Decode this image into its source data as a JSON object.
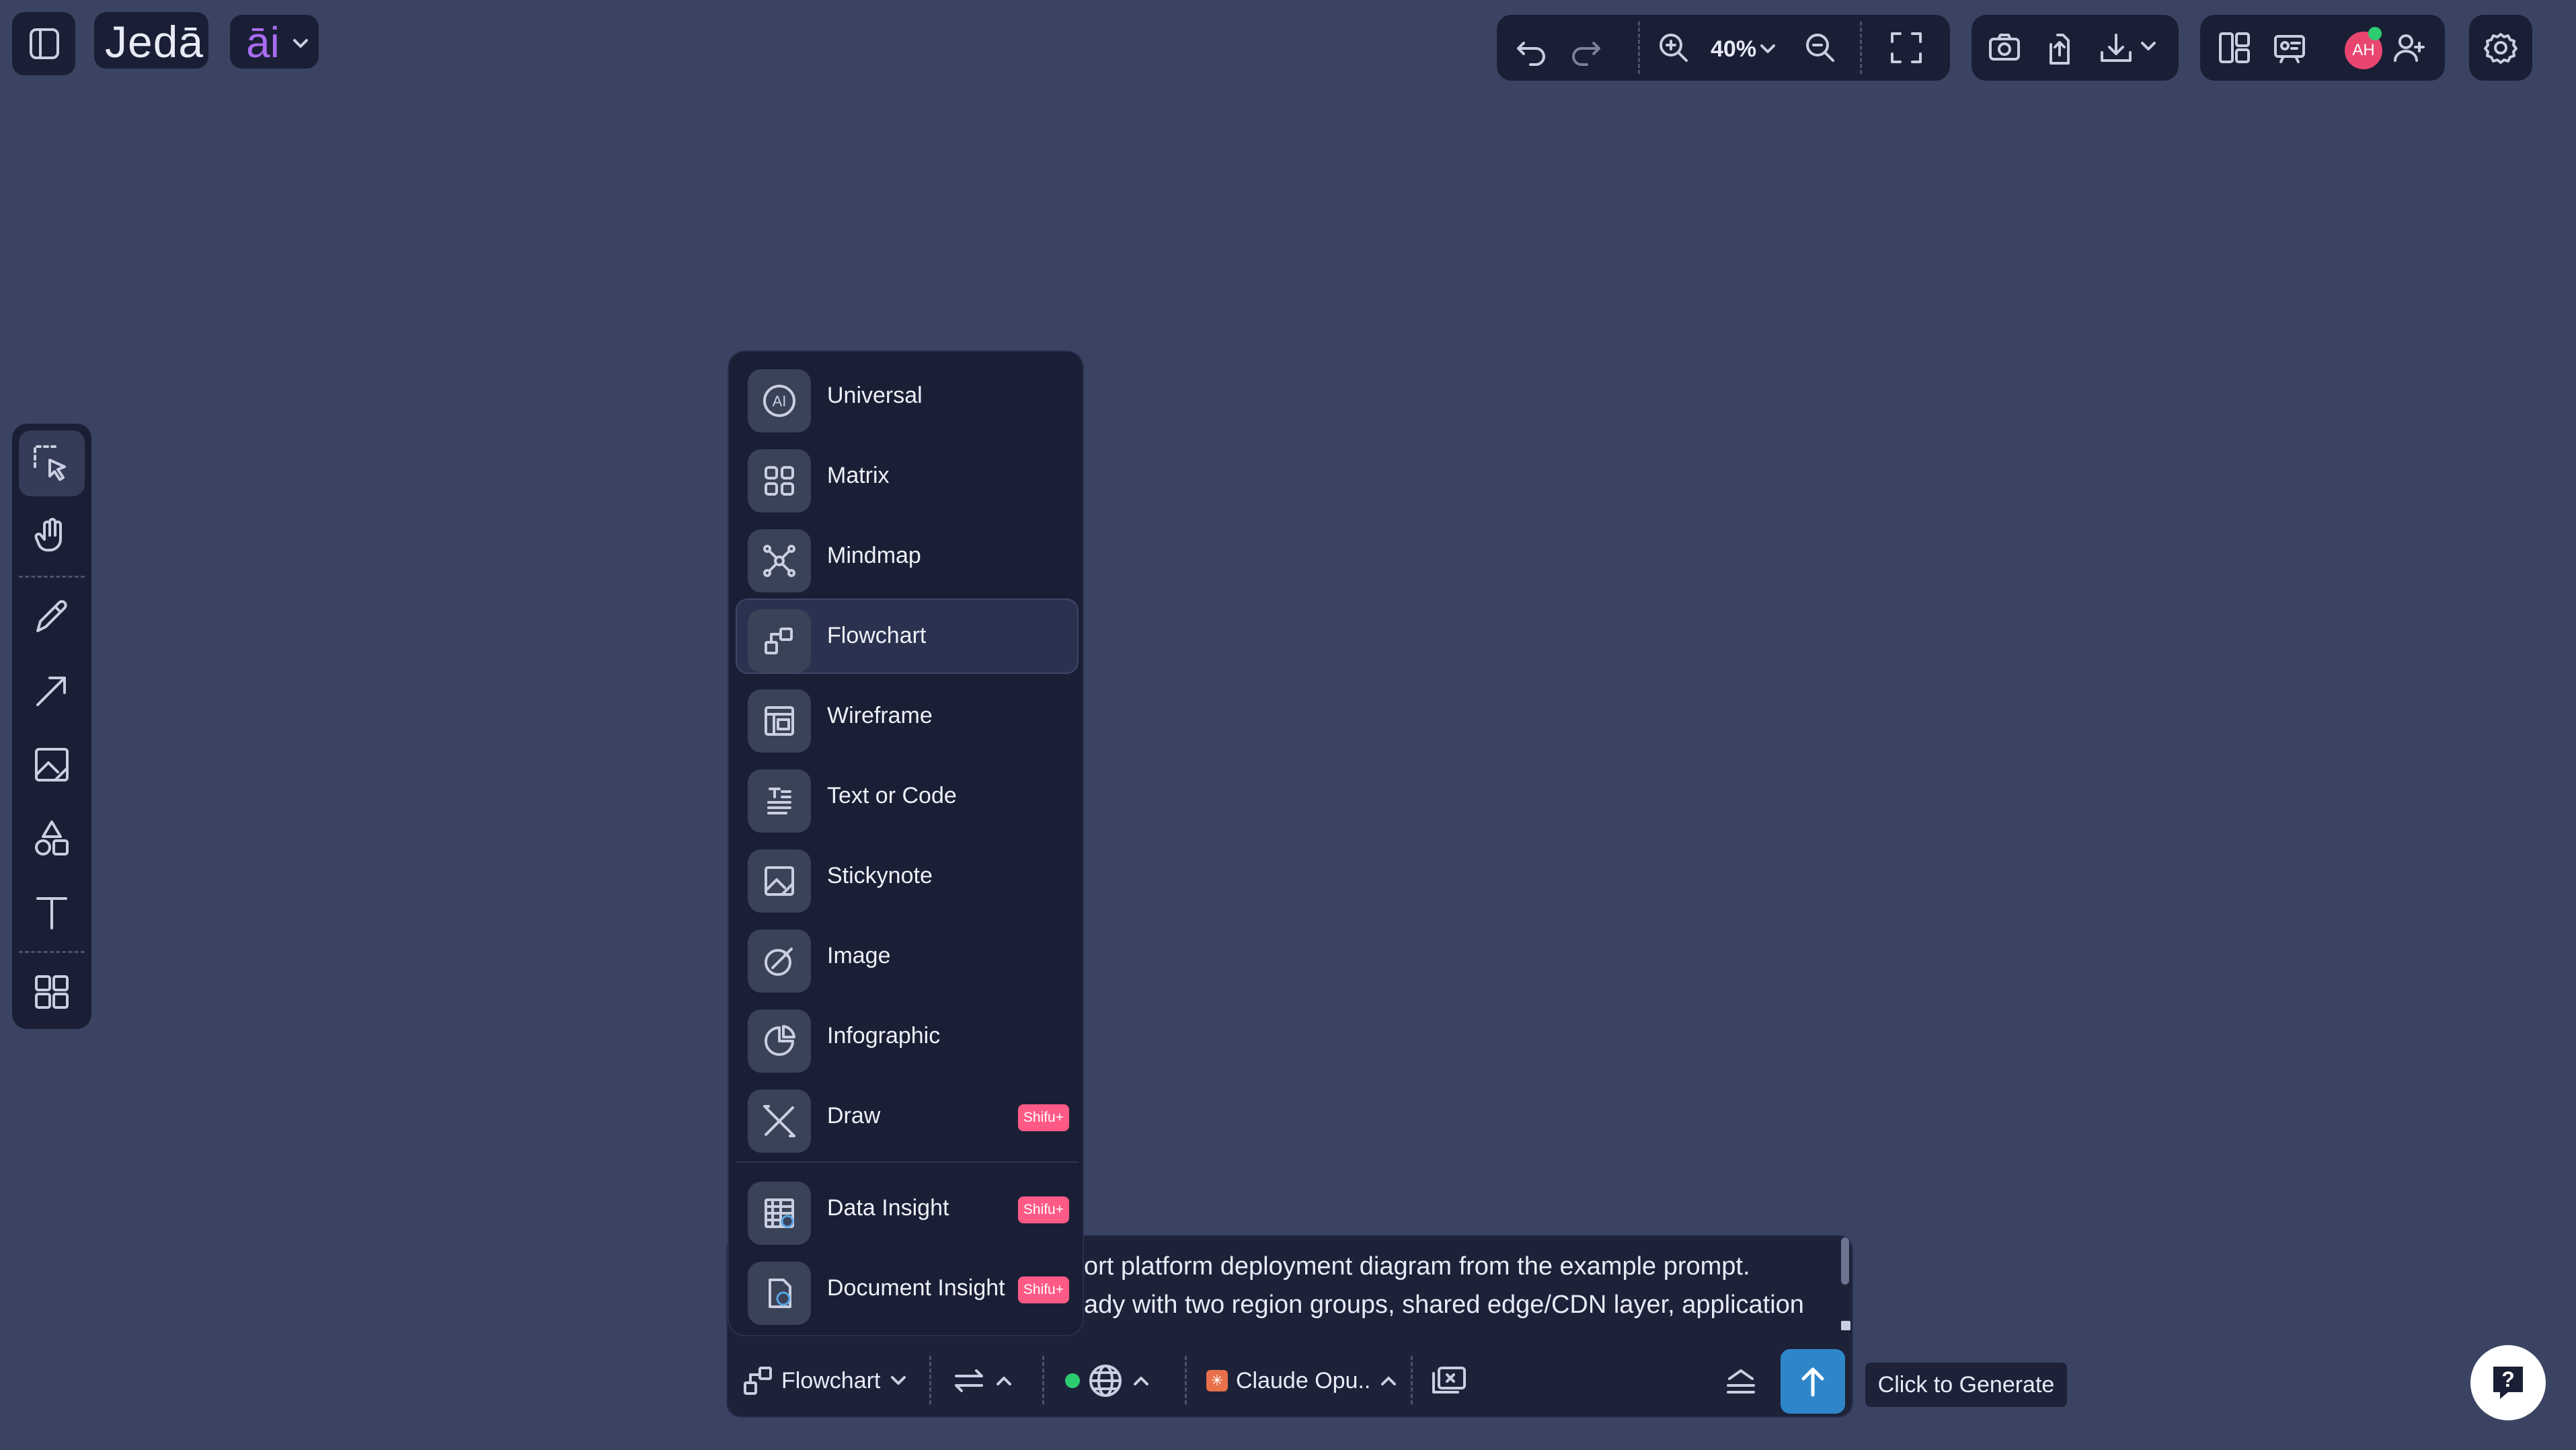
{
  "brand": {
    "logo": "Jedā",
    "ai_label": "āi"
  },
  "toolbar": {
    "zoom": "40%"
  },
  "user": {
    "initials": "AH"
  },
  "dropdown": {
    "items": [
      {
        "label": "Universal",
        "icon": "ai-circle-icon"
      },
      {
        "label": "Matrix",
        "icon": "grid-icon"
      },
      {
        "label": "Mindmap",
        "icon": "mindmap-icon"
      },
      {
        "label": "Flowchart",
        "icon": "flowchart-icon",
        "selected": true
      },
      {
        "label": "Wireframe",
        "icon": "wireframe-icon"
      },
      {
        "label": "Text or Code",
        "icon": "text-code-icon"
      },
      {
        "label": "Stickynote",
        "icon": "stickynote-icon"
      },
      {
        "label": "Image",
        "icon": "image-brush-icon"
      },
      {
        "label": "Infographic",
        "icon": "pie-chart-icon"
      },
      {
        "label": "Draw",
        "icon": "draw-icon",
        "badge": "Shifu+"
      },
      {
        "label": "Data Insight",
        "icon": "data-table-icon",
        "badge": "Shifu+"
      },
      {
        "label": "Document Insight",
        "icon": "document-icon",
        "badge": "Shifu+"
      }
    ]
  },
  "prompt": {
    "line1": "ort platform deployment diagram from the example prompt.",
    "line2": "ady with two region groups, shared edge/CDN layer, application"
  },
  "bottom_bar": {
    "mode": "Flowchart",
    "model": "Claude Opu..",
    "tooltip": "Click to Generate"
  },
  "colors": {
    "background": "#3a4462",
    "panel": "#1a1f35",
    "accent": "#2e86c9",
    "badge": "#ff5a86",
    "avatar": "#e8466f",
    "status_dot": "#2ecc71"
  }
}
